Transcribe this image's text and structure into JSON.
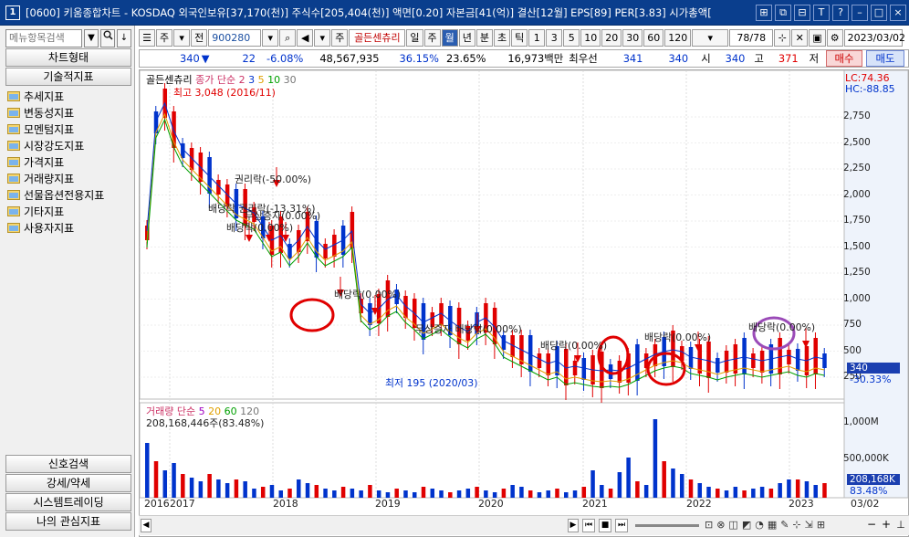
{
  "titlebar": {
    "num": "1",
    "title": "[0600] 키움종합차트 - KOSDAQ 외국인보유[37,170(천)] 주식수[205,404(천)] 액면[0.20] 자본금[41(억)] 결산[12월] EPS[89] PER[3.83] 시가총액[",
    "buttons": [
      "⊞",
      "⧉",
      "⊟",
      "T",
      "?",
      "–",
      "□",
      "×"
    ]
  },
  "sidebar": {
    "search_placeholder": "메뉴항목검색",
    "search_dropdown": "▼",
    "search_icon": "🔍",
    "download_icon": "↓",
    "top_buttons": [
      "차트형태",
      "기술적지표"
    ],
    "items": [
      "추세지표",
      "변동성지표",
      "모멘텀지표",
      "시장강도지표",
      "가격지표",
      "거래량지표",
      "선물옵션전용지표",
      "기타지표",
      "사용자지표"
    ],
    "bottom_buttons": [
      "신호검색",
      "강세/약세",
      "시스템트레이딩",
      "나의 관심지표"
    ]
  },
  "toolbar1": {
    "items": [
      "주",
      "전"
    ],
    "code": "900280",
    "name": "골든센츄리",
    "periods": [
      "일",
      "주",
      "월",
      "년",
      "분",
      "초",
      "틱"
    ],
    "active_period": "월",
    "nums": [
      "1",
      "3",
      "5",
      "10",
      "20",
      "30",
      "60",
      "120"
    ],
    "count": "78/78",
    "date": "2023/03/02"
  },
  "toolbar2": {
    "price": "340",
    "arrow": "▼",
    "change": "22",
    "pct": "-6.08%",
    "volume": "48,567,935",
    "pct2": "36.15%",
    "pct3": "23.65%",
    "amount": "16,973백만",
    "best": "최우선",
    "ask": "341",
    "bid": "340",
    "open_l": "시",
    "open": "340",
    "high_l": "고",
    "high": "371",
    "low_l": "저",
    "low": "331",
    "buy": "매수",
    "sell": "매도"
  },
  "price_pane": {
    "legend_name": "골든센츄리",
    "legend_ma": "종가 단순",
    "ma_periods": [
      "2",
      "3",
      "5",
      "10",
      "30"
    ],
    "lc": "LC:74.36",
    "hc": "HC:-88.85",
    "hi_label": "최고 3,048 (2016/11)",
    "lo_label": "최저 195 (2020/03)",
    "yticks": [
      "2,750",
      "2,500",
      "2,250",
      "2,000",
      "1,750",
      "1,500",
      "1,250",
      "1,000",
      "750",
      "500",
      "250"
    ],
    "cur_price": "340",
    "cur_pct": "-30.33%",
    "annotations": [
      "권리락(-50.00%)",
      "배당락 권리락(-13.31%)",
      "무상증자(0.00%)",
      "배당락(0.00%)",
      "배당락(0.00%)",
      "무상증자 배당락(0.00%)",
      "배당락(0.00%)",
      "배당락(0.00%)",
      "배당락(0.00%)"
    ]
  },
  "volume_pane": {
    "legend": "거래량",
    "legend_ma": "단순",
    "ma_periods": [
      "5",
      "20",
      "60",
      "120"
    ],
    "total": "208,168,446주(83.48%)",
    "yticks": [
      "1,000M",
      "500,000K"
    ],
    "cur": "208,168K",
    "cur_pct": "83.48%"
  },
  "xaxis": {
    "labels": [
      "2016",
      "2017",
      "2018",
      "2019",
      "2020",
      "2021",
      "2022",
      "2023"
    ],
    "end": "03/02"
  }
}
